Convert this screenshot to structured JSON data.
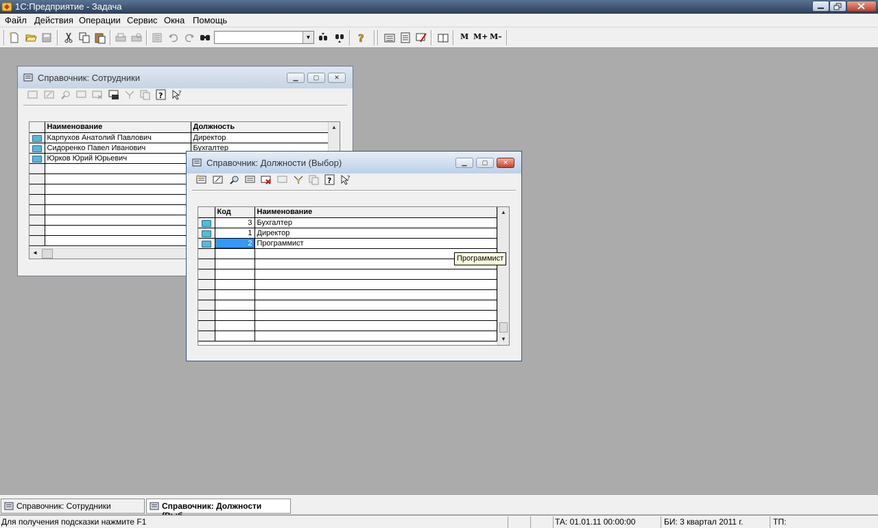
{
  "app": {
    "title": "1С:Предприятие - Задача"
  },
  "menu": [
    "Файл",
    "Действия",
    "Операции",
    "Сервис",
    "Окна",
    "Помощь"
  ],
  "toolbar": {
    "search_value": "",
    "m_label": "М",
    "mplus_label": "М+",
    "mminus_label": "М–",
    "icons": [
      "new-document-icon",
      "open-folder-icon",
      "save-icon",
      "cut-icon",
      "copy-icon",
      "paste-icon",
      "print-icon",
      "print-preview-icon",
      "properties-icon",
      "undo-icon",
      "redo-icon",
      "find-icon",
      "find-next-icon",
      "find-previous-icon",
      "help-icon",
      "calculator-icon",
      "calendar-icon",
      "syntax-assistant-icon",
      "book-icon"
    ]
  },
  "employees_window": {
    "title": "Справочник: Сотрудники",
    "columns": [
      "Наименование",
      "Должность"
    ],
    "rows": [
      [
        "Карпухов Анатолий Павлович",
        "Директор"
      ],
      [
        "Сидоренко Павел Иванович",
        "Бухгалтер"
      ],
      [
        "Юрков Юрий Юрьевич",
        ""
      ]
    ]
  },
  "positions_window": {
    "title": "Справочник: Должности (Выбор)",
    "columns": [
      "Код",
      "Наименование"
    ],
    "rows": [
      [
        "3",
        "Бухгалтер"
      ],
      [
        "1",
        "Директор"
      ],
      [
        "2",
        "Программист"
      ]
    ],
    "selected_row": 2
  },
  "tooltip": "Программист",
  "window_tabs": [
    {
      "label": "Справочник: Сотрудники",
      "selected": false
    },
    {
      "label": "Справочник: Должности (Выб...",
      "selected": true
    }
  ],
  "status": {
    "hint": "Для получения подсказки нажмите F1",
    "ta": "ТА: 01.01.11  00:00:00",
    "bi": "БИ: 3 квартал 2011 г.",
    "tp": "ТП:"
  },
  "colors": {
    "mdi_background": "#ababab",
    "selection": "#3399ff",
    "tooltip_bg": "#ffffe1"
  }
}
